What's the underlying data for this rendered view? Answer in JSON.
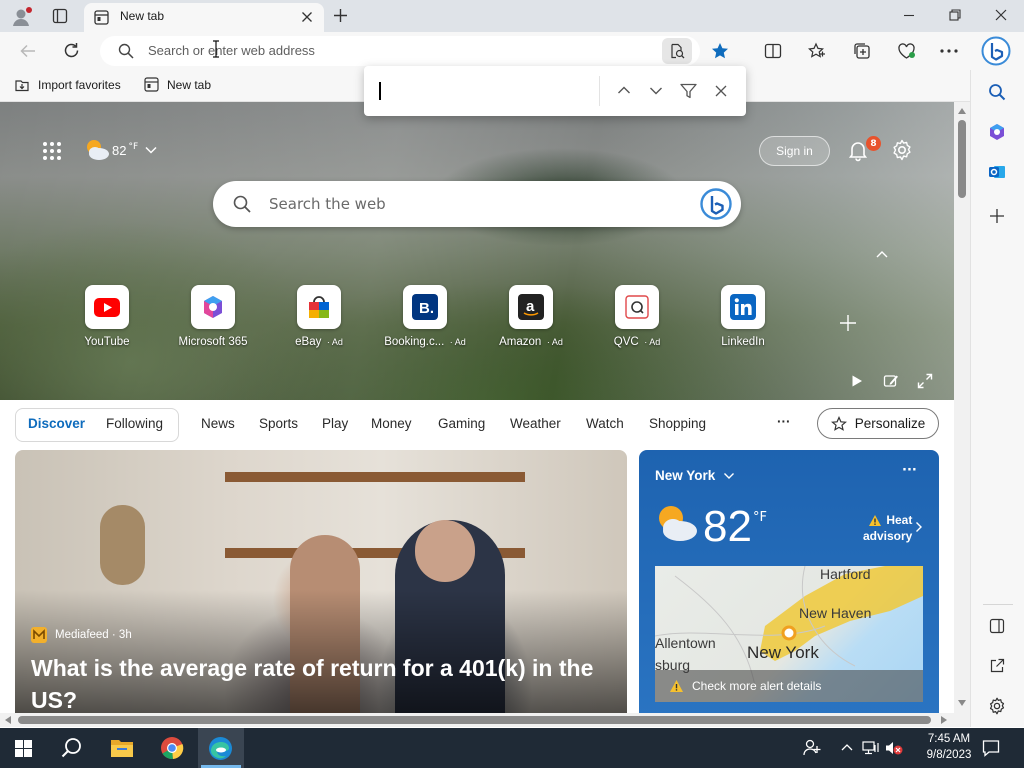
{
  "browser": {
    "tab_title": "New tab",
    "address_placeholder": "Search or enter web address"
  },
  "favorites": {
    "import_label": "Import favorites",
    "newtab_label": "New tab"
  },
  "findbar": {
    "value": ""
  },
  "newtab": {
    "weather_temp": "82",
    "weather_unit": "°F",
    "search_placeholder": "Search the web",
    "signin_label": "Sign in",
    "notification_count": "8",
    "quicklinks": [
      {
        "label": "YouTube",
        "ad": ""
      },
      {
        "label": "Microsoft 365",
        "ad": ""
      },
      {
        "label": "eBay",
        "ad": "Ad"
      },
      {
        "label": "Booking.c...",
        "ad": "Ad"
      },
      {
        "label": "Amazon",
        "ad": "Ad"
      },
      {
        "label": "QVC",
        "ad": "Ad"
      },
      {
        "label": "LinkedIn",
        "ad": ""
      }
    ]
  },
  "feed": {
    "tabs": [
      "Discover",
      "Following"
    ],
    "categories": [
      "News",
      "Sports",
      "Play",
      "Money",
      "Gaming",
      "Weather",
      "Watch",
      "Shopping"
    ],
    "more": "···",
    "personalize_label": "Personalize"
  },
  "article": {
    "source": "Mediafeed · 3h",
    "headline": "What is the average rate of return for a 401(k) in the US?"
  },
  "weather_card": {
    "city": "New York",
    "more": "···",
    "temp": "82",
    "unit": "°F",
    "alert_title": "Heat",
    "alert_sub": "advisory",
    "map_labels": [
      "Hartford",
      "New Haven",
      "Allentown",
      "New York",
      "sburg"
    ],
    "alert_details": "Check more alert details"
  },
  "taskbar": {
    "time": "7:45 AM",
    "date": "9/8/2023"
  },
  "colors": {
    "accent": "#0f6cbd",
    "notification_badge": "#e8532d",
    "weather_card": "#2a74c2",
    "taskbar": "#1f2a36"
  }
}
